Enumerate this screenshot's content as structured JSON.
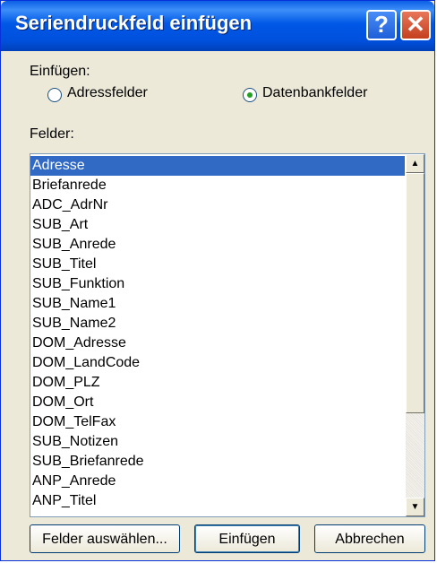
{
  "window": {
    "title": "Seriendruckfeld einfügen",
    "help_glyph": "?",
    "close_glyph": "✕"
  },
  "insert_group": {
    "label": "Einfügen:",
    "options": [
      {
        "label": "Adressfelder",
        "checked": false
      },
      {
        "label": "Datenbankfelder",
        "checked": true
      }
    ]
  },
  "fields": {
    "label": "Felder:",
    "items": [
      "Adresse",
      "Briefanrede",
      "ADC_AdrNr",
      "SUB_Art",
      "SUB_Anrede",
      "SUB_Titel",
      "SUB_Funktion",
      "SUB_Name1",
      "SUB_Name2",
      "DOM_Adresse",
      "DOM_LandCode",
      "DOM_PLZ",
      "DOM_Ort",
      "DOM_TelFax",
      "SUB_Notizen",
      "SUB_Briefanrede",
      "ANP_Anrede",
      "ANP_Titel"
    ],
    "selected": "Adresse"
  },
  "buttons": {
    "select_fields": "Felder auswählen...",
    "insert": "Einfügen",
    "cancel": "Abbrechen"
  },
  "colors": {
    "title_bar": "#0058e6",
    "selection": "#316ac5",
    "dialog_background": "#ece9d8"
  }
}
